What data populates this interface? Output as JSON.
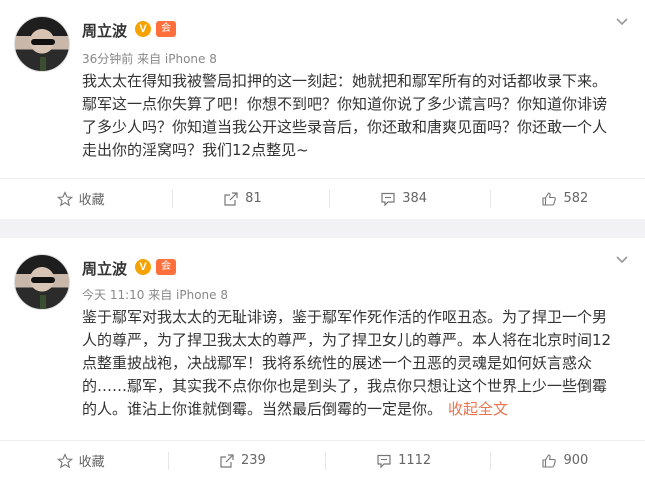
{
  "posts": [
    {
      "user_name": "周立波",
      "verified_badge": "V",
      "member_badge": "会",
      "time_source": "36分钟前 来自 iPhone 8",
      "lines": [
        "我太太在得知我被警局扣押的这一刻起：她就把和鄢军所有的对话都收录下来。",
        "鄢军这一点你失算了吧！你想不到吧？你知道你说了多少谎言吗？你知道你诽谤",
        "了多少人吗？你知道当我公开这些录音后，你还敢和唐爽见面吗？你还敢一个人",
        "走出你的淫窝吗？我们12点整见~"
      ],
      "actions": {
        "favorite": "收藏",
        "repost": "81",
        "comment": "384",
        "like": "582"
      }
    },
    {
      "user_name": "周立波",
      "verified_badge": "V",
      "member_badge": "会",
      "time_source": "今天 11:10 来自 iPhone 8",
      "lines": [
        "鉴于鄢军对我太太的无耻诽谤，鉴于鄢军作死作活的作呕丑态。为了捍卫一个男",
        "人的尊严，为了捍卫我太太的尊严，为了捍卫女儿的尊严。本人将在北京时间12",
        "点整重披战袍，决战鄢军！我将系统性的展述一个丑恶的灵魂是如何妖言惑众",
        "的……鄢军，其实我不点你你也是到头了，我点你只想让这个世界上少一些倒霉",
        "的人。谁沾上你谁就倒霉。当然最后倒霉的一定是你。"
      ],
      "expand_label": "收起全文",
      "actions": {
        "favorite": "收藏",
        "repost": "239",
        "comment": "1112",
        "like": "900"
      }
    }
  ],
  "icons": {
    "more": "chevron-down-icon",
    "favorite": "star-icon",
    "repost": "share-icon",
    "comment": "comment-icon",
    "like": "thumbs-up-icon"
  },
  "colors": {
    "accent": "#eb7350",
    "vip": "#f5a300"
  }
}
